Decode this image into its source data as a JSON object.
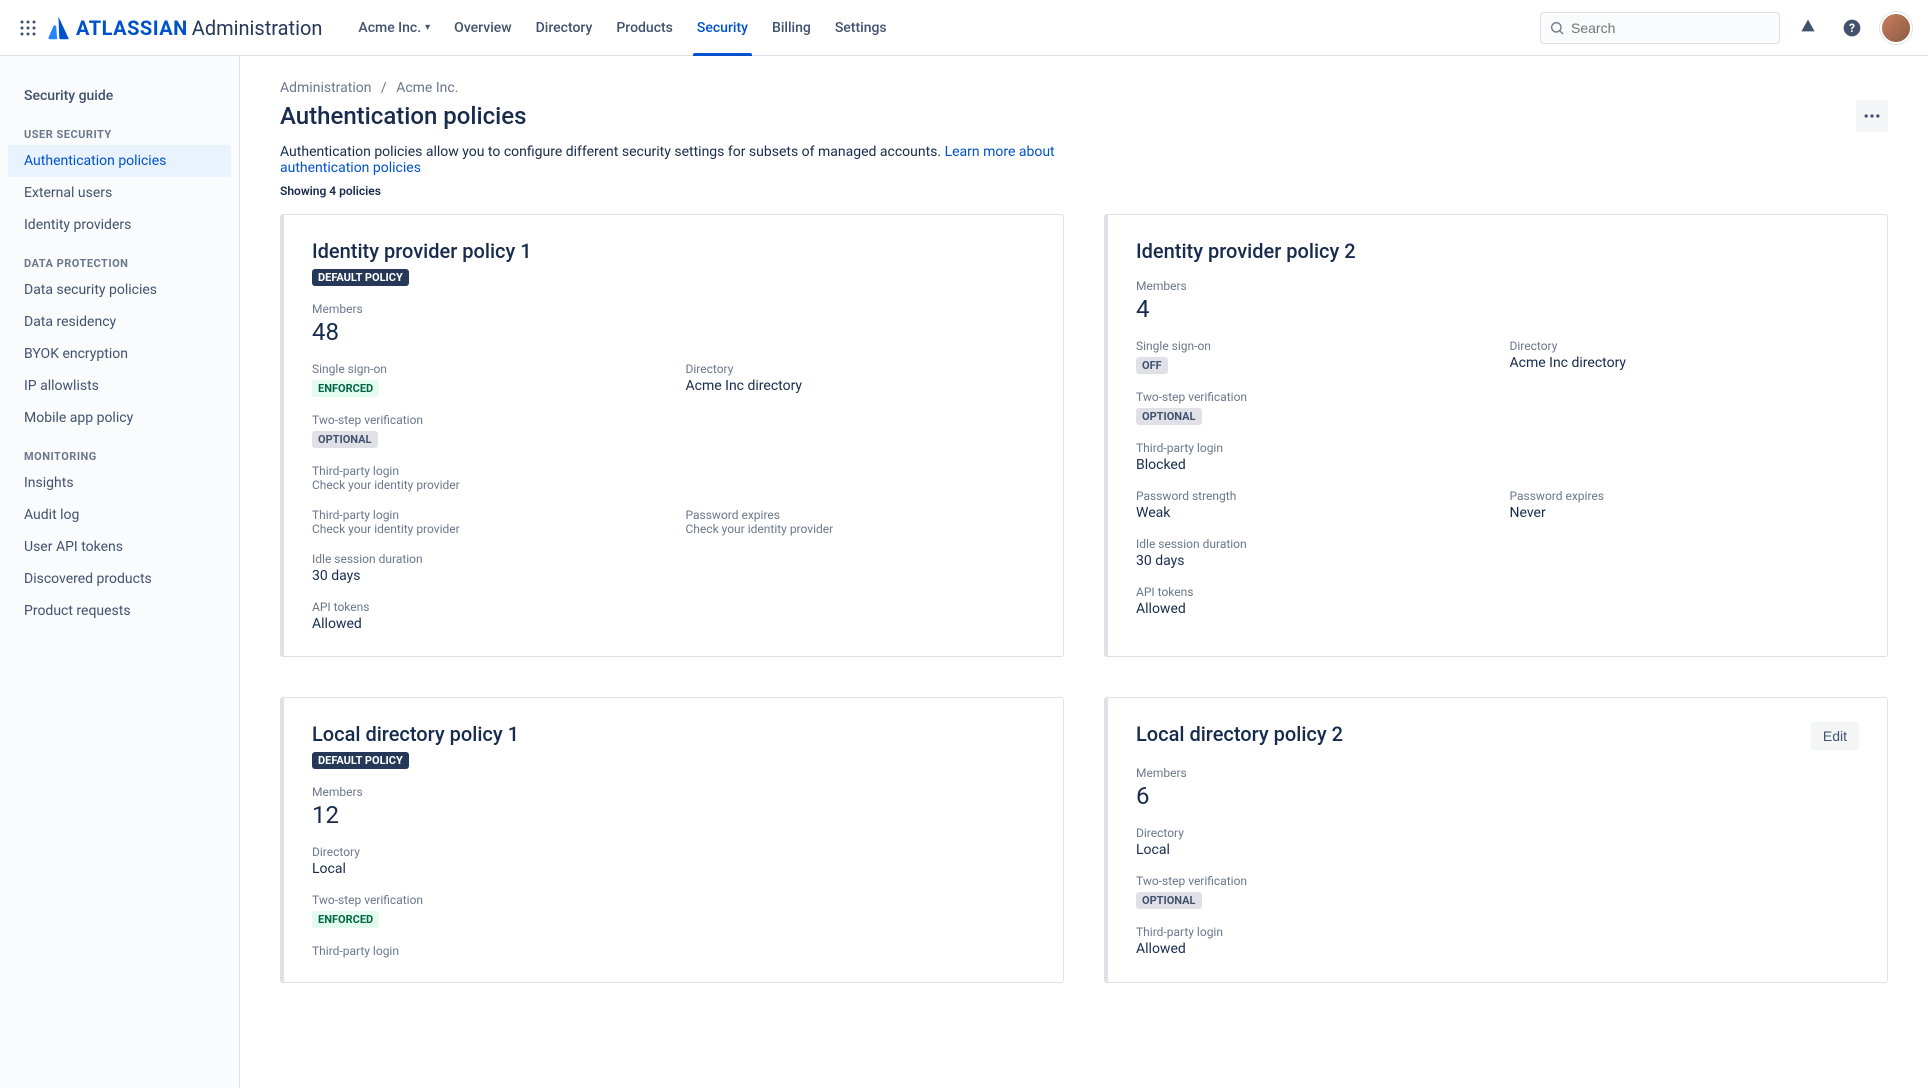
{
  "logo": {
    "brand": "ATLASSIAN",
    "product": "Administration"
  },
  "topTabs": {
    "org": "Acme Inc.",
    "overview": "Overview",
    "directory": "Directory",
    "products": "Products",
    "security": "Security",
    "billing": "Billing",
    "settings": "Settings"
  },
  "search": {
    "placeholder": "Search"
  },
  "sidebar": {
    "guide": "Security guide",
    "userSecurity": {
      "heading": "USER SECURITY",
      "auth": "Authentication policies",
      "external": "External users",
      "idp": "Identity providers"
    },
    "dataProtection": {
      "heading": "DATA PROTECTION",
      "dsp": "Data security policies",
      "residency": "Data residency",
      "byok": "BYOK encryption",
      "ip": "IP allowlists",
      "mobile": "Mobile app policy"
    },
    "monitoring": {
      "heading": "MONITORING",
      "insights": "Insights",
      "audit": "Audit log",
      "userApi": "User API tokens",
      "discovered": "Discovered products",
      "requests": "Product requests"
    }
  },
  "breadcrumb": {
    "admin": "Administration",
    "org": "Acme Inc."
  },
  "page": {
    "title": "Authentication policies",
    "desc": "Authentication policies allow you to configure different security settings for subsets of managed accounts. ",
    "learn": "Learn more about authentication policies",
    "showing": "Showing 4 policies"
  },
  "labels": {
    "members": "Members",
    "sso": "Single sign-on",
    "directory": "Directory",
    "twoStep": "Two-step verification",
    "thirdParty": "Third-party login",
    "pwdExpires": "Password expires",
    "pwdStrength": "Password strength",
    "idle": "Idle session duration",
    "api": "API tokens",
    "defaultPolicy": "DEFAULT POLICY",
    "enforced": "ENFORCED",
    "optional": "OPTIONAL",
    "off": "OFF",
    "check": "Check your identity provider",
    "edit": "Edit"
  },
  "policy1": {
    "title": "Identity provider policy 1",
    "members": "48",
    "directory": "Acme Inc directory",
    "idle": "30 days",
    "api": "Allowed"
  },
  "policy2": {
    "title": "Identity provider policy 2",
    "members": "4",
    "directory": "Acme Inc directory",
    "thirdParty": "Blocked",
    "pwdStrength": "Weak",
    "pwdExpires": "Never",
    "idle": "30 days",
    "api": "Allowed"
  },
  "policy3": {
    "title": "Local directory policy 1",
    "members": "12",
    "directory": "Local",
    "thirdParty": "Third-party login"
  },
  "policy4": {
    "title": "Local directory policy 2",
    "members": "6",
    "directory": "Local",
    "thirdParty": "Allowed"
  }
}
